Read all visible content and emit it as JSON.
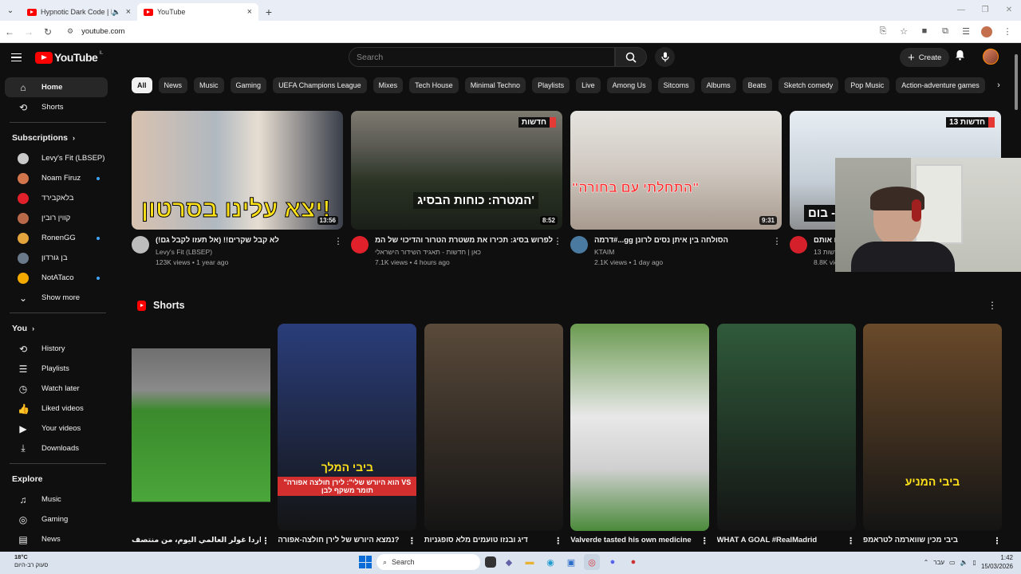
{
  "browser": {
    "tabs": [
      {
        "title": "Hypnotic Dark Code | Futur",
        "active": false,
        "audio": true
      },
      {
        "title": "YouTube",
        "active": true,
        "audio": false
      }
    ],
    "url": "youtube.com"
  },
  "header": {
    "logo_text": "YouTube",
    "region": "IL",
    "search_placeholder": "Search",
    "create_label": "Create"
  },
  "sidebar": {
    "main": [
      {
        "label": "Home",
        "icon": "home-icon"
      },
      {
        "label": "Shorts",
        "icon": "shorts-icon"
      }
    ],
    "subscriptions_title": "Subscriptions",
    "subscriptions": [
      {
        "label": "Levy's Fit (LBSEP)",
        "color": "#c9c9c9",
        "dot": false
      },
      {
        "label": "Noam Firuz",
        "color": "#d2744c",
        "dot": true
      },
      {
        "label": "בלאקבירד",
        "color": "#e0202a",
        "dot": false
      },
      {
        "label": "קווין רובין",
        "color": "#b8694a",
        "dot": false
      },
      {
        "label": "RonenGG",
        "color": "#e3a33d",
        "dot": true
      },
      {
        "label": "בן גורדון",
        "color": "#6b7a8a",
        "dot": false
      },
      {
        "label": "NotATaco",
        "color": "#f2a900",
        "dot": true
      }
    ],
    "show_more": "Show more",
    "you_title": "You",
    "you_items": [
      {
        "label": "History",
        "icon": "history-icon"
      },
      {
        "label": "Playlists",
        "icon": "playlists-icon"
      },
      {
        "label": "Watch later",
        "icon": "watch-later-icon"
      },
      {
        "label": "Liked videos",
        "icon": "liked-icon"
      },
      {
        "label": "Your videos",
        "icon": "your-videos-icon"
      },
      {
        "label": "Downloads",
        "icon": "downloads-icon"
      }
    ],
    "explore_title": "Explore",
    "explore_items": [
      {
        "label": "Music",
        "icon": "music-icon"
      },
      {
        "label": "Gaming",
        "icon": "gaming-icon"
      },
      {
        "label": "News",
        "icon": "news-icon"
      }
    ]
  },
  "chips": [
    "All",
    "News",
    "Music",
    "Gaming",
    "UEFA Champions League",
    "Mixes",
    "Tech House",
    "Minimal Techno",
    "Playlists",
    "Live",
    "Among Us",
    "Sitcoms",
    "Albums",
    "Beats",
    "Sketch comedy",
    "Pop Music",
    "Action-adventure games"
  ],
  "videos": [
    {
      "title": "לא קבל שקרים!! (אל תעזו לקבל גם!)",
      "channel": "Levy's Fit (LBSEP)",
      "stats": "123K views • 1 year ago",
      "duration": "13:56",
      "overlay": "יצא עלינו בסרטון!",
      "avatar_color": "#bdbdbd"
    },
    {
      "title": "לפרוש בסיג: תכירו את משטרת הטרור והדיכוי של המשטר האיראני, כוח הבסיג'",
      "channel": "כאן | חדשות - תאגיד השידור הישראלי",
      "stats": "7.1K views • 4 hours ago",
      "duration": "8:52",
      "overlay": "המטרה: כוחות הבסיג'",
      "badge": "חדשות",
      "avatar_color": "#e0202a"
    },
    {
      "title": "הסולחה בין איתן נסים לרונן gg...#דרמה",
      "channel": "KTAIM",
      "stats": "2.1K views • 1 day ago",
      "duration": "9:31",
      "overlay": "\"התחלתי עם בחורה\"",
      "avatar_color": "#4a7aa0"
    },
    {
      "title": "אנשים שלא ידעו שמצלמים אותם",
      "channel": "חדשות 13",
      "stats": "8.8K views • 7 hours ago",
      "duration": "",
      "overlay": "ראן - בום",
      "badge": "חדשות 13",
      "avatar_color": "#d4202a"
    }
  ],
  "shorts_title": "Shorts",
  "shorts": [
    {
      "title": "هدف اردا غولر العالمي اليوم، من منتصف",
      "bg": "#2f6b2a"
    },
    {
      "title": "נמצא היורש של לירן חולצה-אפורה?",
      "overlay": "ביבי המלך",
      "caption": "\"הוא היורש שלי\": לירן חולצה אפורה VS תומר משקף לבן",
      "bg": "#2a3d7a"
    },
    {
      "title": "דיג ובנזו טועמים מלא סופגניות",
      "bg": "#5a4a3a"
    },
    {
      "title": "Valverde tasted his own medicine",
      "bg": "#3d7a3a"
    },
    {
      "title": "WHAT A GOAL #RealMadrid",
      "bg": "#2f5a3a"
    },
    {
      "title": "ביבי מכין שווארמה לטראמפ",
      "overlay": "ביבי המניע",
      "bg": "#6a4a2a"
    }
  ],
  "taskbar": {
    "temp": "18°C",
    "weather": "סעוק רב-היום",
    "search": "Search",
    "lang": "עבר",
    "time": "1:42",
    "date": "15/03/2026"
  }
}
